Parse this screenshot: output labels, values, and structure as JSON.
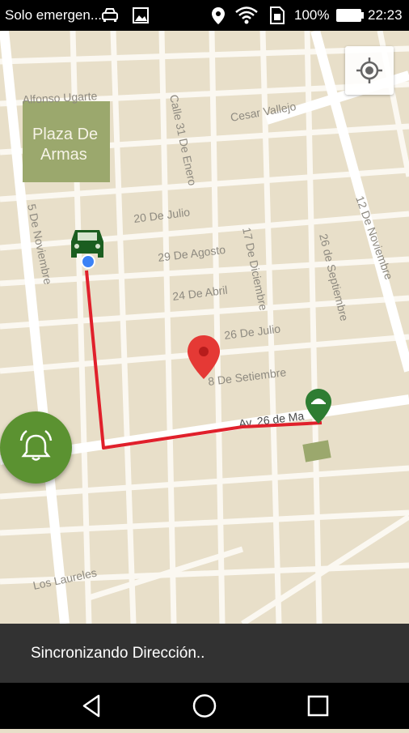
{
  "status_bar": {
    "carrier": "Solo emergen...",
    "battery": "100%",
    "time": "22:23"
  },
  "map": {
    "plaza_line1": "Plaza De",
    "plaza_line2": "Armas",
    "streets": {
      "alfonso_ugarte": "Alfonso Ugarte",
      "cesar_vallejo": "Cesar Vallejo",
      "calle_31_de_enero": "Calle 31 De Enero",
      "veinte_de_julio": "20 De Julio",
      "veintinueve_de_agosto": "29 De Agosto",
      "veinticuatro_de_abril": "24 De Abril",
      "diecisiete_de_diciembre": "17 De Diciembre",
      "veintiseis_de_julio": "26 De Julio",
      "veintiseis_de_septiembre": "26 de Septiembre",
      "ocho_de_setiembre": "8 De Setiembre",
      "cinco_de_noviembre": "5 De Noviembre",
      "doce_de_noviembre": "12 De Noviembre",
      "av_26_de_mayo": "Av. 26 de Ma",
      "los_laureles": "Los Laureles"
    }
  },
  "snackbar": {
    "message": "Sincronizando Dirección.."
  },
  "colors": {
    "route": "#e0202b",
    "fab": "#5b9231",
    "car": "#1b5e20"
  }
}
